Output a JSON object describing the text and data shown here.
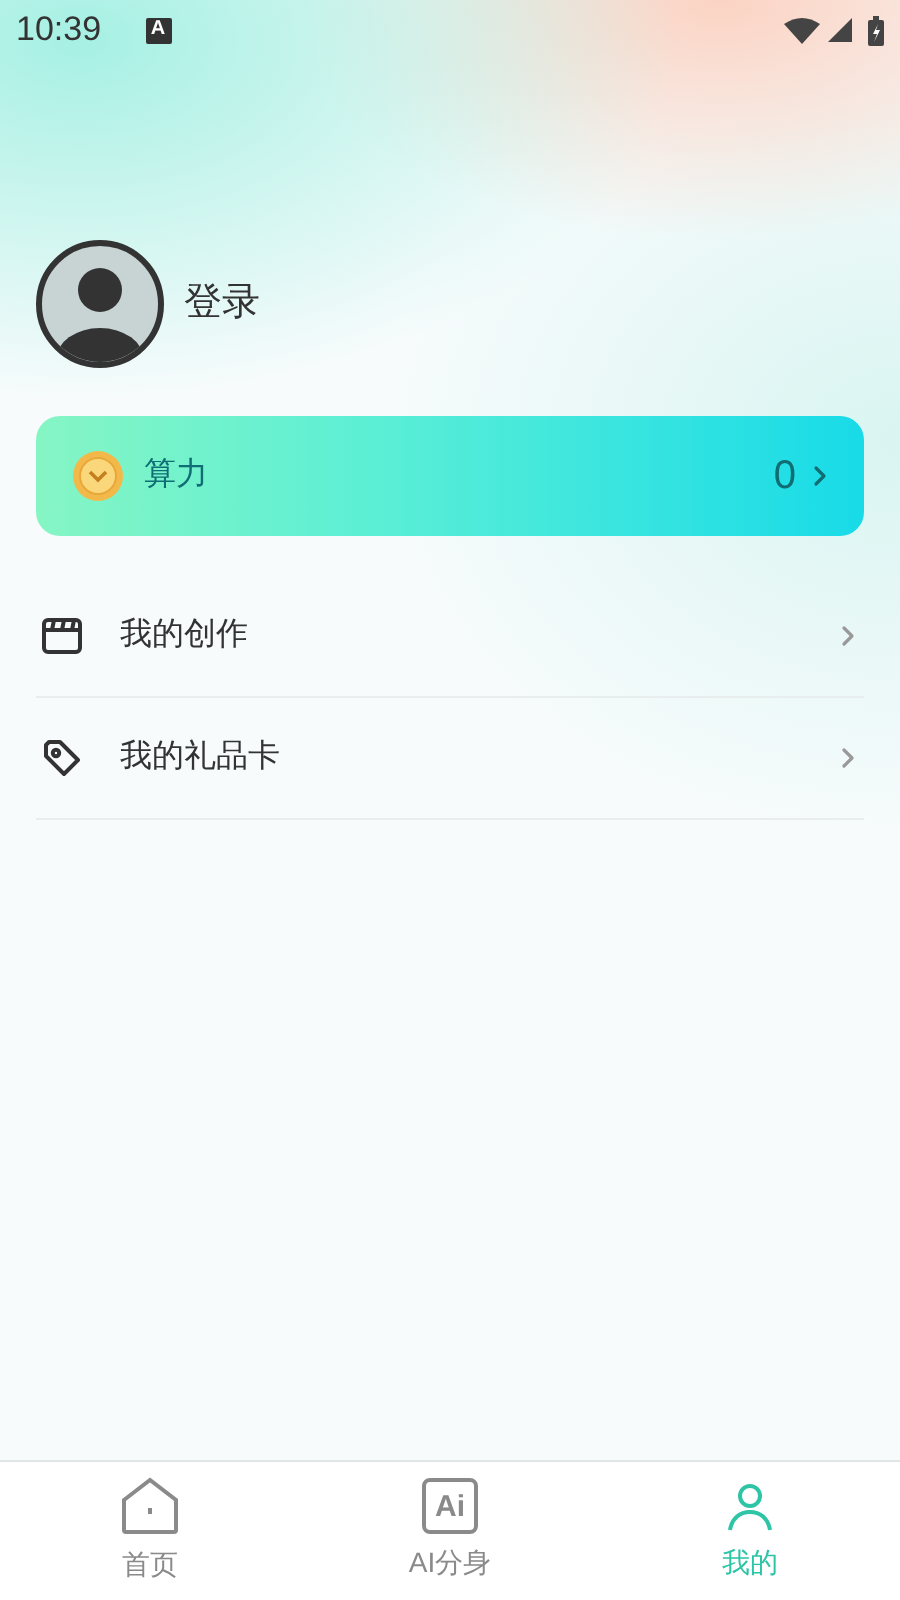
{
  "status_bar": {
    "time": "10:39",
    "badge": "A"
  },
  "profile": {
    "login": "登录"
  },
  "points_card": {
    "label": "算力",
    "value": "0"
  },
  "menu": [
    {
      "kind": "film",
      "label": "我的创作"
    },
    {
      "kind": "tag",
      "label": "我的礼品卡"
    }
  ],
  "tab_bar": [
    {
      "kind": "home",
      "label": "首页",
      "selected": false
    },
    {
      "kind": "ai",
      "icon_text": "Ai",
      "label": "AI分身",
      "selected": false
    },
    {
      "kind": "user",
      "label": "我的",
      "selected": true
    }
  ]
}
